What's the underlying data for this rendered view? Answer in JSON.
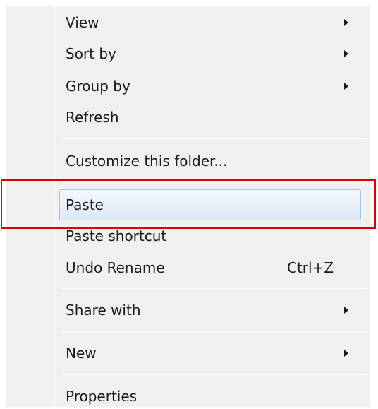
{
  "menu": {
    "items": [
      {
        "label": "View",
        "submenu": true
      },
      {
        "label": "Sort by",
        "submenu": true
      },
      {
        "label": "Group by",
        "submenu": true
      },
      {
        "label": "Refresh"
      },
      {
        "label": "Customize this folder..."
      },
      {
        "label": "Paste",
        "highlighted": true
      },
      {
        "label": "Paste shortcut"
      },
      {
        "label": "Undo Rename",
        "shortcut": "Ctrl+Z"
      },
      {
        "label": "Share with",
        "submenu": true
      },
      {
        "label": "New",
        "submenu": true
      },
      {
        "label": "Properties"
      }
    ]
  },
  "colors": {
    "highlight_border": "#a6c2e4",
    "highlight_fill": "#dde8f6",
    "annotation": "#e00000",
    "menu_background": "#f0f0f0"
  }
}
